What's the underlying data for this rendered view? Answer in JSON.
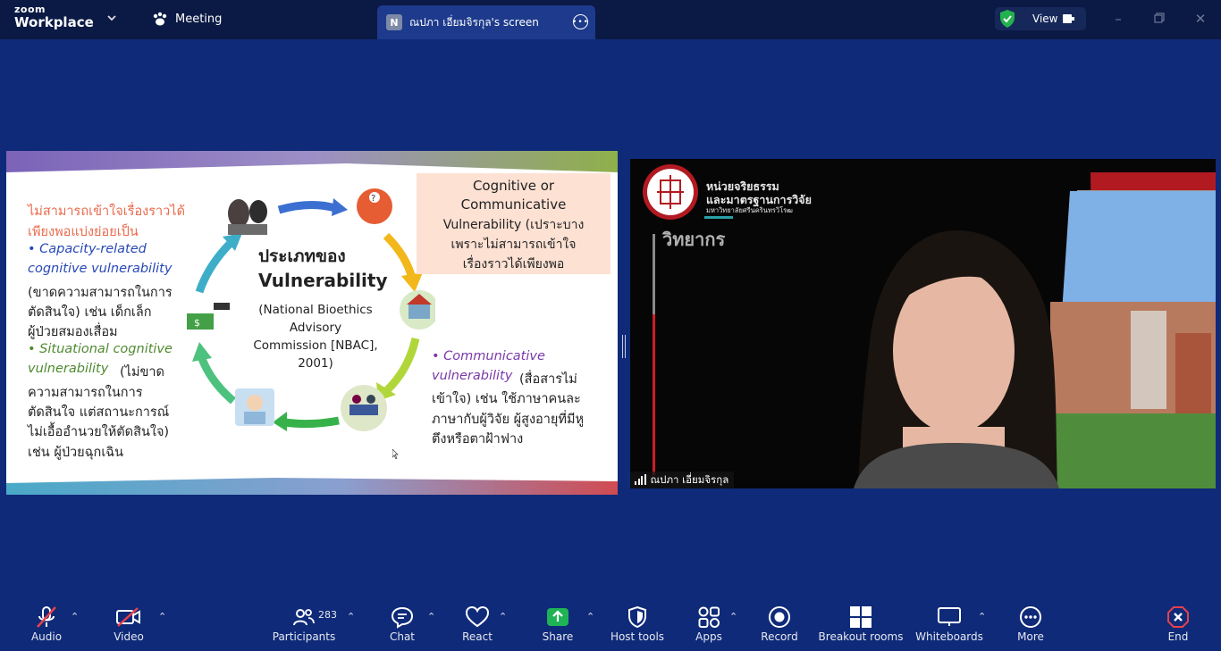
{
  "app": {
    "logo_top": "zoom",
    "logo_bottom": "Workplace",
    "meeting_label": "Meeting",
    "share_tab": {
      "badge": "N",
      "title": "ณปภา เอี่ยมจิรกุล's screen"
    },
    "view_label": "View"
  },
  "slide": {
    "left_heading_1": "ไม่สามารถเข้าใจเรื่องราวได้",
    "left_heading_2": "เพียงพอแบ่งย่อยเป็น",
    "left_lines": [
      "• Capacity-related",
      "cognitive vulnerability",
      "(ขาดความสามารถในการ",
      "ตัดสินใจ) เช่น เด็กเล็ก",
      "ผู้ป่วยสมองเสื่อม",
      "• Situational cognitive",
      "vulnerability",
      "(ไม่ขาด",
      "ความสามารถในการ",
      "ตัดสินใจ แต่สถานะการณ์",
      "ไม่เอื้ออำนวยให้ตัดสินใจ)",
      "เช่น ผู้ป่วยฉุกเฉิน"
    ],
    "center_title_1": "ประเภทของ",
    "center_title_2": "Vulnerability",
    "center_source": [
      "(National Bioethics",
      "Advisory",
      "Commission [NBAC],",
      "2001)"
    ],
    "box_lines": [
      "Cognitive or",
      "Communicative",
      "Vulnerability (เปราะบาง",
      "เพราะไม่สามารถเข้าใจ",
      "เรื่องราวได้เพียงพอ"
    ],
    "right_lines": [
      "• Communicative",
      "vulnerability",
      "(สื่อสารไม่",
      "เข้าใจ) เช่น ใช้ภาษาคนละ",
      "ภาษากับผู้วิจัย ผู้สูงอายุที่มีหู",
      "ตึงหรือตาฝ้าฟาง"
    ]
  },
  "video": {
    "org_line_1": "หน่วยจริยธรรม",
    "org_line_2": "และมาตรฐานการวิจัย",
    "org_line_3": "มหาวิทยาลัยศรีนครินทรวิโรฒ",
    "role_label": "วิทยากร",
    "participant_name": "ณปภา เอี่ยมจิรกุล"
  },
  "toolbar": {
    "audio": "Audio",
    "video": "Video",
    "participants": "Participants",
    "participants_count": "283",
    "chat": "Chat",
    "react": "React",
    "share": "Share",
    "host_tools": "Host tools",
    "apps": "Apps",
    "record": "Record",
    "breakout": "Breakout rooms",
    "whiteboards": "Whiteboards",
    "more": "More",
    "end": "End"
  },
  "colors": {
    "background": "#0f2a78",
    "topbar": "#0b1a45",
    "share_green": "#1fb356",
    "end_red": "#e8414a"
  },
  "icons": [
    "audio-muted-icon",
    "video-off-icon",
    "participants-icon",
    "chat-icon",
    "heart-icon",
    "share-arrow-icon",
    "shield-icon",
    "apps-icon",
    "record-icon",
    "grid-icon",
    "whiteboard-icon",
    "more-dots-icon",
    "end-icon"
  ]
}
